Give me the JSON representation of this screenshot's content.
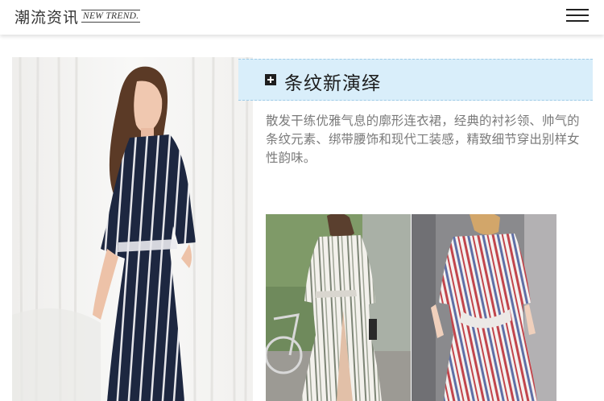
{
  "header": {
    "logo_cn": "潮流资讯",
    "logo_en": "NEW TREND."
  },
  "section": {
    "title": "条纹新演绎",
    "description": "散发干练优雅气息的廓形连衣裙，经典的衬衫领、帅气的条纹元素、绑带腰饰和现代工装感，精致细节穿出别样女性韵味。"
  },
  "icons": {
    "menu": "hamburger-menu-icon",
    "section_marker": "plus-square-icon"
  },
  "colors": {
    "header_bg": "#ffffff",
    "section_head_bg": "#d9eefa",
    "description_text": "#7a7a7a",
    "title_text": "#1b1b1b"
  }
}
